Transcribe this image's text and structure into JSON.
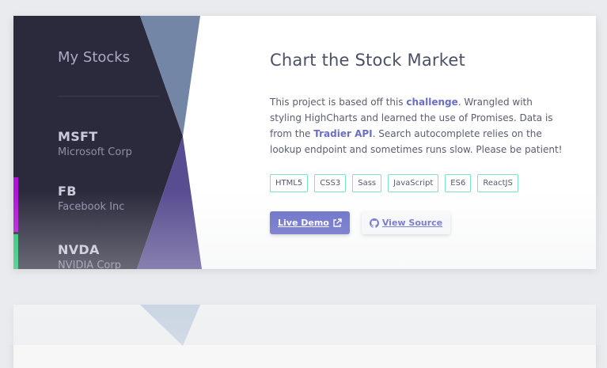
{
  "project": {
    "sidebar": {
      "title": "My Stocks",
      "stocks": [
        {
          "symbol": "MSFT",
          "name": "Microsoft Corp"
        },
        {
          "symbol": "FB",
          "name": "Facebook Inc",
          "accent": "#b012d6"
        },
        {
          "symbol": "NVDA",
          "name": "NVIDIA Corp",
          "accent": "#1fc56d"
        }
      ]
    },
    "title": "Chart the Stock Market",
    "description": {
      "part1": "This project is based off this ",
      "link1": "challenge",
      "part2": ". Wrangled with styling HighCharts and learned the use of Promises. Data is from the ",
      "link2": "Tradier API",
      "part3": ". Search autocomplete relies on the lookup endpoint and sometimes runs slow. Please be patient!"
    },
    "tags": [
      "HTML5",
      "CSS3",
      "Sass",
      "JavaScript",
      "ES6",
      "ReactJS"
    ],
    "buttons": {
      "live_demo": "Live Demo",
      "view_source": "View Source"
    }
  },
  "colors": {
    "accent": "#6a6ec9",
    "tag_border": "#7fe3c0",
    "sidebar_bg": "#2b2a3c",
    "triangle_top": "#7486a6",
    "triangle_bottom": "#594d91"
  },
  "icons": {
    "live_demo": "external-link-icon",
    "view_source": "github-icon"
  }
}
